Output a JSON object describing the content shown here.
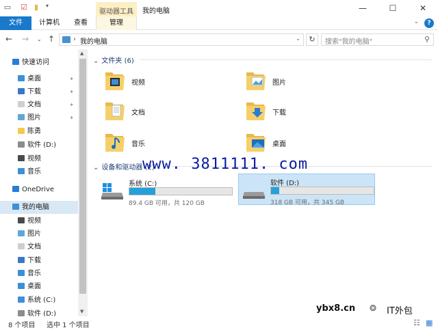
{
  "window": {
    "title": "我的电脑",
    "context_tab": "驱动器工具",
    "buttons": {
      "minimize": "—",
      "maximize": "☐",
      "close": "✕"
    }
  },
  "ribbon": {
    "tabs": [
      "文件",
      "计算机",
      "查看",
      "管理"
    ],
    "help": "?"
  },
  "address": {
    "path": "我的电脑",
    "search_placeholder": "搜索\"我的电脑\""
  },
  "nav": {
    "items": [
      {
        "label": "快速访问",
        "icon": "star-icon",
        "color": "#2b7cd3"
      },
      {
        "label": "桌面",
        "icon": "desktop-icon",
        "color": "#3c8fd8",
        "pinned": true
      },
      {
        "label": "下载",
        "icon": "download-icon",
        "color": "#3778c8",
        "pinned": true
      },
      {
        "label": "文档",
        "icon": "document-icon",
        "color": "#cfcfcf",
        "pinned": true
      },
      {
        "label": "图片",
        "icon": "picture-icon",
        "color": "#60a7d8",
        "pinned": true
      },
      {
        "label": "陈勇",
        "icon": "folder-icon",
        "color": "#f3c94e"
      },
      {
        "label": "软件 (D:)",
        "icon": "drive-icon",
        "color": "#8c8c8c"
      },
      {
        "label": "视频",
        "icon": "video-icon",
        "color": "#4a4a4a"
      },
      {
        "label": "音乐",
        "icon": "music-icon",
        "color": "#3c8fd8"
      },
      {
        "label": "OneDrive",
        "icon": "onedrive-icon",
        "color": "#2b7cd3"
      },
      {
        "label": "我的电脑",
        "icon": "computer-icon",
        "color": "#3c8fd8"
      },
      {
        "label": "视频",
        "icon": "video-icon",
        "color": "#4a4a4a"
      },
      {
        "label": "图片",
        "icon": "picture-icon",
        "color": "#60a7d8"
      },
      {
        "label": "文档",
        "icon": "document-icon",
        "color": "#cfcfcf"
      },
      {
        "label": "下载",
        "icon": "download-icon",
        "color": "#3778c8"
      },
      {
        "label": "音乐",
        "icon": "music-icon",
        "color": "#3c8fd8"
      },
      {
        "label": "桌面",
        "icon": "desktop-icon",
        "color": "#3c8fd8"
      },
      {
        "label": "系统 (C:)",
        "icon": "system-drive-icon",
        "color": "#3c8fd8"
      },
      {
        "label": "软件 (D:)",
        "icon": "drive-icon",
        "color": "#8c8c8c"
      }
    ]
  },
  "folders_group": {
    "title": "文件夹 (6)",
    "items": [
      {
        "label": "视频",
        "icon": "video-folder-icon"
      },
      {
        "label": "图片",
        "icon": "pictures-folder-icon"
      },
      {
        "label": "文档",
        "icon": "documents-folder-icon"
      },
      {
        "label": "下载",
        "icon": "downloads-folder-icon"
      },
      {
        "label": "音乐",
        "icon": "music-folder-icon"
      },
      {
        "label": "桌面",
        "icon": "desktop-folder-icon"
      }
    ]
  },
  "drives_group": {
    "title": "设备和驱动器 (2)",
    "items": [
      {
        "label": "系统 (C:)",
        "info": "89.4 GB 可用，共 120 GB",
        "used_fraction": 0.255
      },
      {
        "label": "软件 (D:)",
        "info": "318 GB 可用，共 345 GB",
        "used_fraction": 0.078
      }
    ]
  },
  "status": {
    "count": "8 个项目",
    "selection": "选中 1 个项目"
  },
  "watermarks": {
    "main": "www. 3811111. com",
    "site": "ybx8.cn",
    "brand": "IT外包"
  },
  "colors": {
    "accent": "#1979ca",
    "selection": "#cce4f7",
    "drive_bar": "#26a0da"
  }
}
